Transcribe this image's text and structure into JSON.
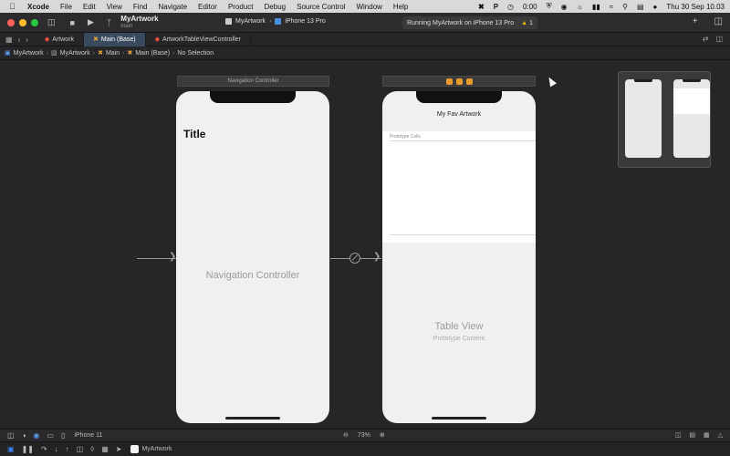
{
  "menubar": {
    "app": "Xcode",
    "items": [
      "File",
      "Edit",
      "View",
      "Find",
      "Navigate",
      "Editor",
      "Product",
      "Debug",
      "Source Control",
      "Window",
      "Help"
    ],
    "timer": "0:00",
    "clock": "Thu 30 Sep  10.03"
  },
  "toolbar": {
    "scheme_name": "MyArtwork",
    "branch": "main",
    "target_app": "MyArtwork",
    "target_device": "iPhone 13 Pro",
    "activity": "Running MyArtwork on iPhone 13 Pro",
    "warning_count": "1"
  },
  "tabs": [
    {
      "label": "Artwork",
      "type": "swift"
    },
    {
      "label": "Main (Base)",
      "type": "storyboard",
      "active": true
    },
    {
      "label": "ArtworkTableViewController",
      "type": "swift"
    }
  ],
  "jumpbar": {
    "crumbs": [
      "MyArtwork",
      "MyArtwork",
      "Main",
      "Main (Base)",
      "No Selection"
    ]
  },
  "scenes": {
    "nav_scene_title": "Navigation Controller",
    "nav_large_title": "Title",
    "nav_placeholder": "Navigation Controller",
    "table_nav_title": "My Fav Artwork",
    "prototype_cells": "Prototype Cells",
    "table_view_label": "Table View",
    "prototype_content": "Prototype Content"
  },
  "bottombar": {
    "device": "iPhone 11",
    "zoom": "73%"
  },
  "debugbar": {
    "app": "MyArtwork"
  },
  "colors": {
    "accent": "#3c82f6",
    "canvas": "#262626",
    "warning": "#f0b400",
    "swift": "#f05138"
  }
}
